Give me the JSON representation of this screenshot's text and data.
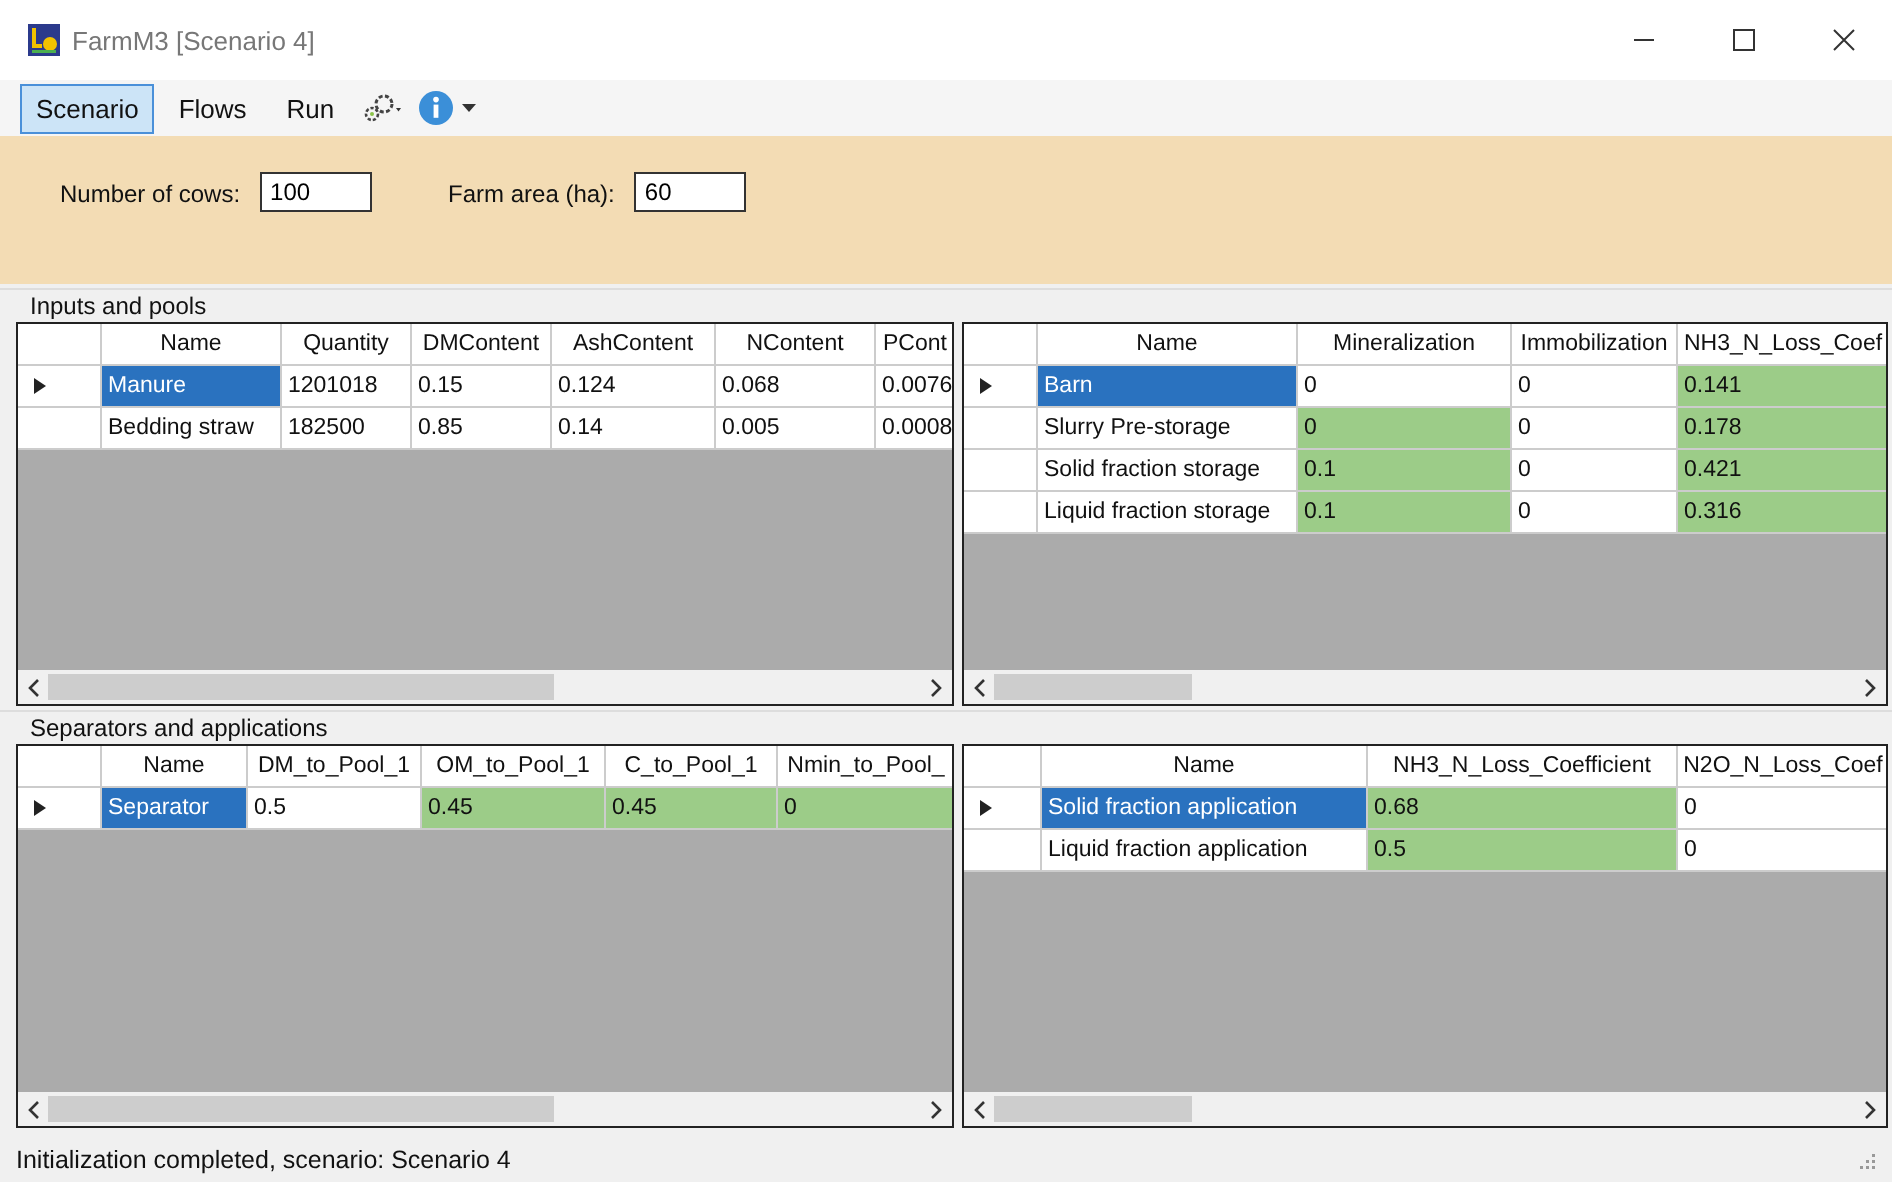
{
  "window": {
    "title": "FarmM3 [Scenario 4]"
  },
  "menu": {
    "items": [
      {
        "label": "Scenario",
        "selected": true
      },
      {
        "label": "Flows",
        "selected": false
      },
      {
        "label": "Run",
        "selected": false
      }
    ]
  },
  "fields": [
    {
      "label": "Number of cows:",
      "value": "100"
    },
    {
      "label": "Farm area (ha):",
      "value": "60"
    }
  ],
  "sections": [
    {
      "title": "Inputs and pools",
      "grids": [
        {
          "columns": [
            "Name",
            "Quantity",
            "DMContent",
            "AshContent",
            "NContent",
            "PCont"
          ],
          "rows": [
            {
              "selected": true,
              "cells": [
                {
                  "text": "Manure",
                  "highlight": false
                },
                {
                  "text": "1201018",
                  "highlight": false
                },
                {
                  "text": "0.15",
                  "highlight": false
                },
                {
                  "text": "0.124",
                  "highlight": false
                },
                {
                  "text": "0.068",
                  "highlight": false
                },
                {
                  "text": "0.0076",
                  "highlight": false
                }
              ]
            },
            {
              "selected": false,
              "cells": [
                {
                  "text": "Bedding straw",
                  "highlight": false
                },
                {
                  "text": "182500",
                  "highlight": false
                },
                {
                  "text": "0.85",
                  "highlight": false
                },
                {
                  "text": "0.14",
                  "highlight": false
                },
                {
                  "text": "0.005",
                  "highlight": false
                },
                {
                  "text": "0.0008",
                  "highlight": false
                }
              ]
            }
          ]
        },
        {
          "columns": [
            "Name",
            "Mineralization",
            "Immobilization",
            "NH3_N_Loss_Coef"
          ],
          "rows": [
            {
              "selected": true,
              "cells": [
                {
                  "text": "Barn",
                  "highlight": false
                },
                {
                  "text": "0",
                  "highlight": false
                },
                {
                  "text": "0",
                  "highlight": false
                },
                {
                  "text": "0.141",
                  "highlight": true
                }
              ]
            },
            {
              "selected": false,
              "cells": [
                {
                  "text": "Slurry Pre-storage",
                  "highlight": false
                },
                {
                  "text": "0",
                  "highlight": true
                },
                {
                  "text": "0",
                  "highlight": false
                },
                {
                  "text": "0.178",
                  "highlight": true
                }
              ]
            },
            {
              "selected": false,
              "cells": [
                {
                  "text": "Solid fraction storage",
                  "highlight": false
                },
                {
                  "text": "0.1",
                  "highlight": true
                },
                {
                  "text": "0",
                  "highlight": false
                },
                {
                  "text": "0.421",
                  "highlight": true
                }
              ]
            },
            {
              "selected": false,
              "cells": [
                {
                  "text": "Liquid fraction storage",
                  "highlight": false
                },
                {
                  "text": "0.1",
                  "highlight": true
                },
                {
                  "text": "0",
                  "highlight": false
                },
                {
                  "text": "0.316",
                  "highlight": true
                }
              ]
            }
          ]
        }
      ]
    },
    {
      "title": "Separators and applications",
      "grids": [
        {
          "columns": [
            "Name",
            "DM_to_Pool_1",
            "OM_to_Pool_1",
            "C_to_Pool_1",
            "Nmin_to_Pool_"
          ],
          "rows": [
            {
              "selected": true,
              "cells": [
                {
                  "text": "Separator",
                  "highlight": false
                },
                {
                  "text": "0.5",
                  "highlight": false
                },
                {
                  "text": "0.45",
                  "highlight": true
                },
                {
                  "text": "0.45",
                  "highlight": true
                },
                {
                  "text": "0",
                  "highlight": true
                }
              ]
            }
          ]
        },
        {
          "columns": [
            "Name",
            "NH3_N_Loss_Coefficient",
            "N2O_N_Loss_Coef"
          ],
          "rows": [
            {
              "selected": true,
              "cells": [
                {
                  "text": "Solid fraction application",
                  "highlight": false
                },
                {
                  "text": "0.68",
                  "highlight": true
                },
                {
                  "text": "0",
                  "highlight": false
                }
              ]
            },
            {
              "selected": false,
              "cells": [
                {
                  "text": "Liquid fraction application",
                  "highlight": false
                },
                {
                  "text": "0.5",
                  "highlight": true
                },
                {
                  "text": "0",
                  "highlight": false
                }
              ]
            }
          ]
        }
      ]
    }
  ],
  "status_bar": {
    "text": "Initialization completed, scenario: Scenario 4"
  }
}
